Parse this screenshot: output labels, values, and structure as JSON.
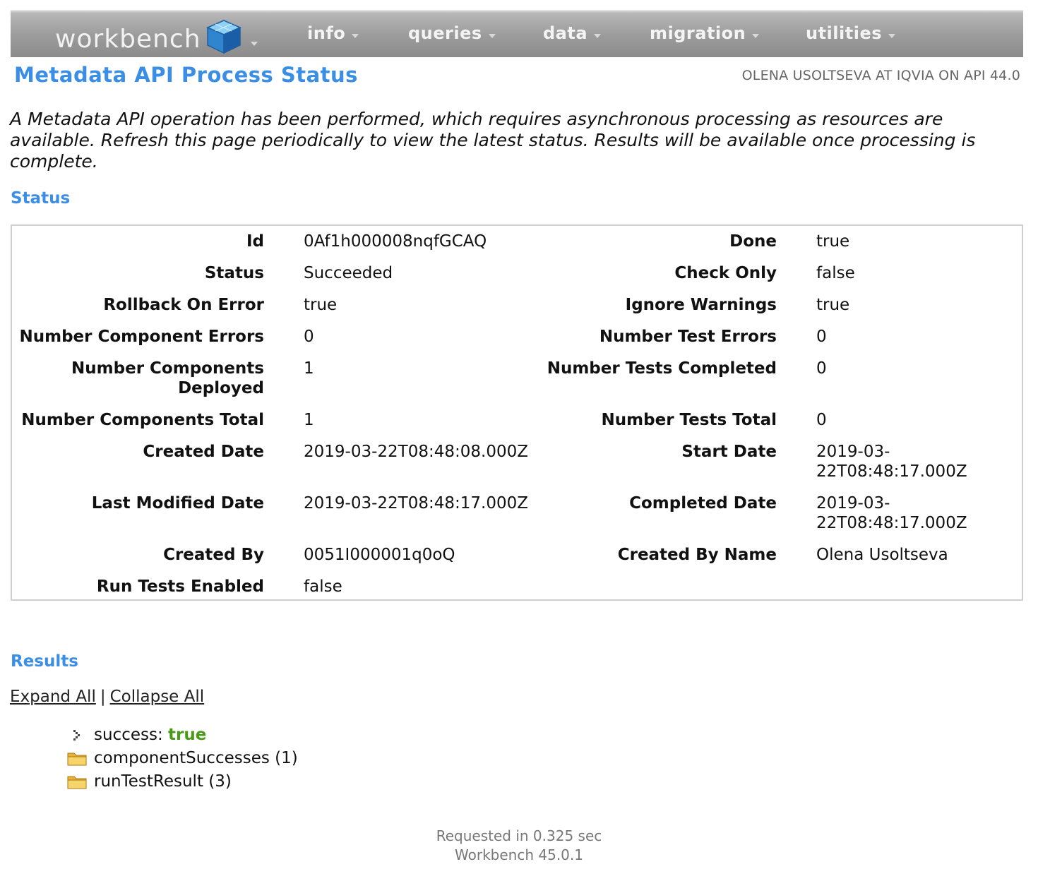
{
  "nav": {
    "brand": "workbench",
    "menus": [
      "info",
      "queries",
      "data",
      "migration",
      "utilities"
    ]
  },
  "header": {
    "title": "Metadata API Process Status",
    "user_info": "OLENA USOLTSEVA AT IQVIA ON API 44.0"
  },
  "intro": "A Metadata API operation has been performed, which requires asynchronous processing as resources are available. Refresh this page periodically to view the latest status. Results will be available once processing is complete.",
  "status": {
    "heading": "Status",
    "rows": [
      {
        "l1": "Id",
        "v1": "0Af1h000008nqfGCAQ",
        "l2": "Done",
        "v2": "true"
      },
      {
        "l1": "Status",
        "v1": "Succeeded",
        "l2": "Check Only",
        "v2": "false"
      },
      {
        "l1": "Rollback On Error",
        "v1": "true",
        "l2": "Ignore Warnings",
        "v2": "true"
      },
      {
        "l1": "Number Component Errors",
        "v1": "0",
        "l2": "Number Test Errors",
        "v2": "0"
      },
      {
        "l1": "Number Components Deployed",
        "v1": "1",
        "l2": "Number Tests Completed",
        "v2": "0"
      },
      {
        "l1": "Number Components Total",
        "v1": "1",
        "l2": "Number Tests Total",
        "v2": "0"
      },
      {
        "l1": "Created Date",
        "v1": "2019-03-22T08:48:08.000Z",
        "l2": "Start Date",
        "v2": "2019-03-22T08:48:17.000Z"
      },
      {
        "l1": "Last Modified Date",
        "v1": "2019-03-22T08:48:17.000Z",
        "l2": "Completed Date",
        "v2": "2019-03-22T08:48:17.000Z"
      },
      {
        "l1": "Created By",
        "v1": "0051I000001q0oQ",
        "l2": "Created By Name",
        "v2": "Olena Usoltseva"
      },
      {
        "l1": "Run Tests Enabled",
        "v1": "false",
        "l2": "",
        "v2": ""
      }
    ]
  },
  "results": {
    "heading": "Results",
    "expand_all": "Expand All",
    "separator": "|",
    "collapse_all": "Collapse All",
    "success_key": "success:",
    "success_value": "true",
    "folders": [
      {
        "name": "componentSuccesses",
        "count": "(1)"
      },
      {
        "name": "runTestResult",
        "count": "(3)"
      }
    ]
  },
  "footer": {
    "timing": "Requested in 0.325 sec",
    "version": "Workbench 45.0.1"
  },
  "colors": {
    "accent": "#3a8ee6",
    "true_value": "#4a9a1a"
  }
}
